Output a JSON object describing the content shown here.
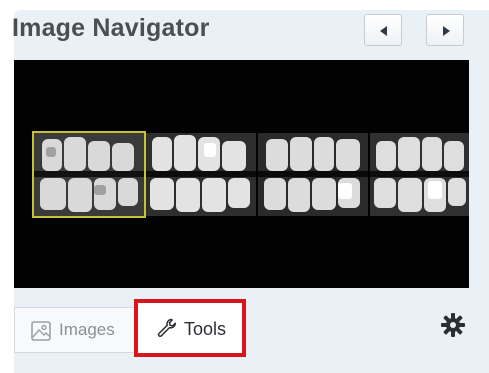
{
  "panel": {
    "title": "Image Navigator",
    "prev_icon": "triangle-left-icon",
    "next_icon": "triangle-right-icon"
  },
  "viewer": {
    "background": "#020202",
    "thumbnails": [
      {
        "selected": true
      },
      {
        "selected": false
      },
      {
        "selected": false
      },
      {
        "selected": false
      }
    ],
    "selection_color": "#c8c233"
  },
  "tabs": {
    "images_label": "Images",
    "images_icon": "picture-icon",
    "tools_label": "Tools",
    "tools_icon": "wrench-icon",
    "highlight_color": "#d9141b"
  },
  "settings_icon": "gear-icon"
}
